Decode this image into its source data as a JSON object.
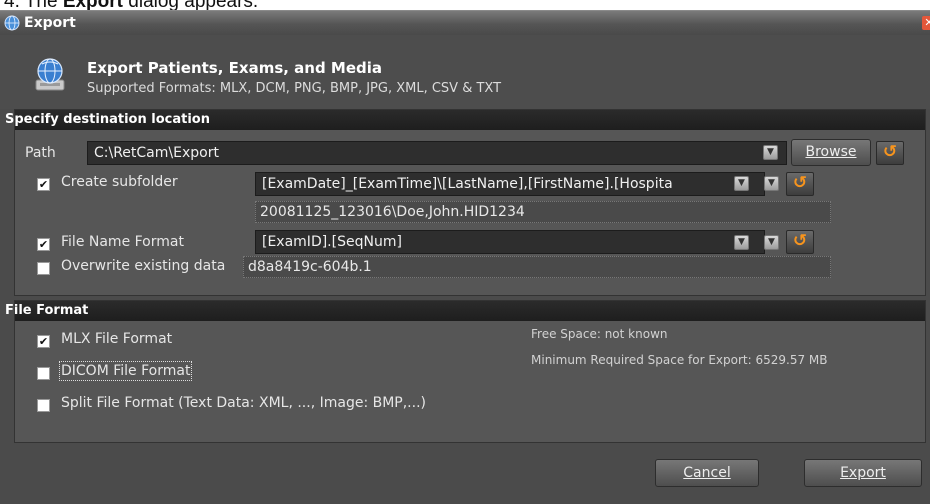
{
  "caption": {
    "prefix": "4. The ",
    "bold": "Export",
    "suffix": " dialog appears."
  },
  "window": {
    "title": "Export",
    "close_glyph": "✕"
  },
  "header": {
    "title": "Export Patients, Exams, and Media",
    "subtitle": "Supported Formats: MLX, DCM, PNG, BMP, JPG, XML, CSV & TXT"
  },
  "destination": {
    "section_title": "Specify destination location",
    "path_label": "Path",
    "path_value": "C:\\RetCam\\Export",
    "browse_label": "Browse",
    "create_subfolder": {
      "label": "Create subfolder",
      "checked": true,
      "value": "[ExamDate]_[ExamTime]\\[LastName],[FirstName].[Hospita",
      "preview": "20081125_123016\\Doe,John.HID1234"
    },
    "file_name_format": {
      "label": "File Name Format",
      "checked": true,
      "value": "[ExamID].[SeqNum]"
    },
    "overwrite": {
      "label": "Overwrite existing data",
      "checked": false,
      "preview": "d8a8419c-604b.1"
    }
  },
  "file_format": {
    "section_title": "File Format",
    "options": [
      {
        "label": "MLX File Format",
        "checked": true
      },
      {
        "label": "DICOM File Format",
        "checked": false
      },
      {
        "label": "Split File Format (Text Data: XML, ..., Image: BMP,...)",
        "checked": false
      }
    ],
    "free_space": "Free Space: not known",
    "required_space": "Minimum Required Space for Export: 6529.57 MB"
  },
  "footer": {
    "cancel_label": "Cancel",
    "export_label": "Export"
  },
  "icons": {
    "check": "✔",
    "dropdown": "▼",
    "reset": "↺"
  },
  "colors": {
    "accent_orange": "#f7941d",
    "close_red": "#e3573a"
  }
}
